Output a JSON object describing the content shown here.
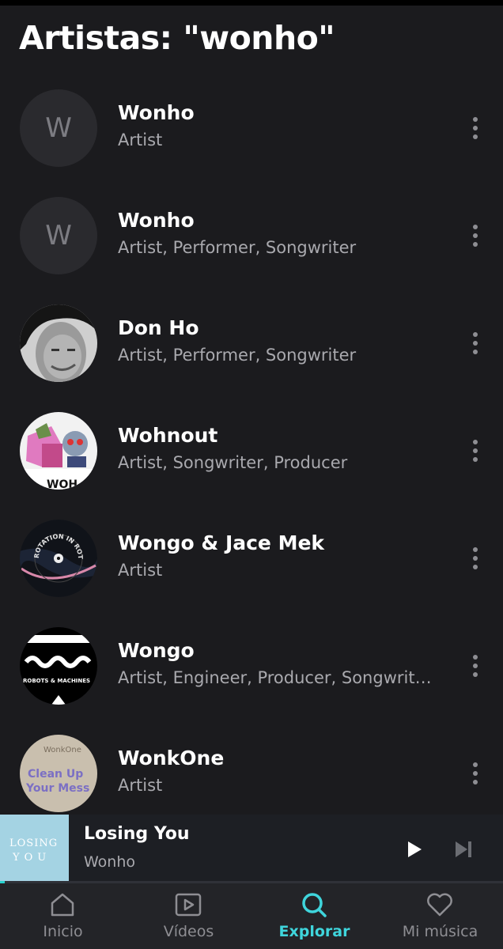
{
  "page": {
    "title": "Artistas: \"wonho\""
  },
  "results": [
    {
      "name": "Wonho",
      "roles": "Artist",
      "avatar": "letter",
      "letter": "W"
    },
    {
      "name": "Wonho",
      "roles": "Artist, Performer, Songwriter",
      "avatar": "letter",
      "letter": "W"
    },
    {
      "name": "Don Ho",
      "roles": "Artist, Performer, Songwriter",
      "avatar": "photo-portrait"
    },
    {
      "name": "Wohnout",
      "roles": "Artist, Songwriter, Producer",
      "avatar": "illustration"
    },
    {
      "name": "Wongo & Jace Mek",
      "roles": "Artist",
      "avatar": "vinyl-record",
      "avatar_text": "ROTATION IN ROTATION"
    },
    {
      "name": "Wongo",
      "roles": "Artist, Engineer, Producer, Songwrit…",
      "avatar": "logo-waves",
      "avatar_text": "ROBOTS & MACHINES"
    },
    {
      "name": "WonkOne",
      "roles": "Artist",
      "avatar": "text-art",
      "avatar_text": "WonkOne Clean Up Your Mess"
    }
  ],
  "now_playing": {
    "track": "Losing You",
    "artist": "Wonho",
    "art_text": "LOSING YOU",
    "progress": 0.01
  },
  "tabs": [
    {
      "label": "Inicio",
      "icon": "home-icon",
      "active": false
    },
    {
      "label": "Vídeos",
      "icon": "video-icon",
      "active": false
    },
    {
      "label": "Explorar",
      "icon": "search-icon",
      "active": true
    },
    {
      "label": "Mi música",
      "icon": "heart-icon",
      "active": false
    }
  ],
  "colors": {
    "accent": "#3fd5dc",
    "background": "#1b1b1e",
    "secondary_text": "#a9a9ae"
  }
}
